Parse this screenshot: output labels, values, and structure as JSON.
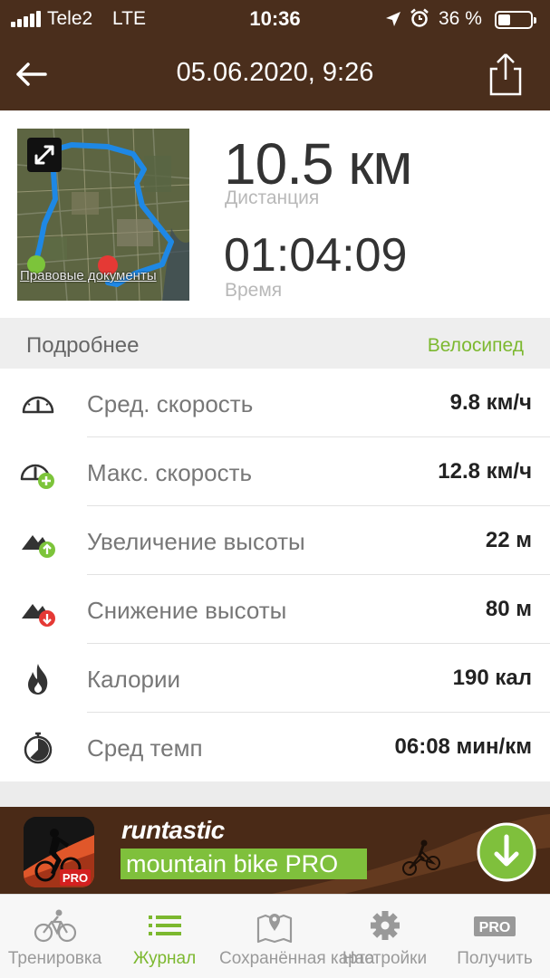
{
  "status_bar": {
    "carrier": "Tele2",
    "network": "LTE",
    "time": "10:36",
    "battery_percent": "36 %",
    "battery_level": 0.36,
    "icons": [
      "signal-icon",
      "location-arrow-icon",
      "alarm-icon",
      "battery-icon"
    ]
  },
  "header": {
    "title": "05.06.2020, 9:26",
    "back_icon": "back-arrow-icon",
    "share_icon": "share-icon"
  },
  "summary": {
    "map_legal": "Правовые документы",
    "distance_value": "10.5 км",
    "distance_label": "Дистанция",
    "time_value": "01:04:09",
    "time_label": "Время"
  },
  "details": {
    "title": "Подробнее",
    "sport": "Велосипед",
    "rows": [
      {
        "icon": "speedometer-icon",
        "label": "Сред. скорость",
        "value": "9.8 км/ч"
      },
      {
        "icon": "speedometer-plus-icon",
        "label": "Макс. скорость",
        "value": "12.8 км/ч"
      },
      {
        "icon": "elevation-gain-icon",
        "label": "Увеличение высоты",
        "value": "22 м"
      },
      {
        "icon": "elevation-loss-icon",
        "label": "Снижение высоты",
        "value": "80 м"
      },
      {
        "icon": "flame-icon",
        "label": "Калории",
        "value": "190 кал"
      },
      {
        "icon": "stopwatch-icon",
        "label": "Сред темп",
        "value": "06:08 мин/км"
      }
    ]
  },
  "ad": {
    "brand": "runtastic",
    "product": "mountain bike PRO",
    "badge": "PRO",
    "colors": {
      "background": "#4a2a17",
      "accent": "#7fc03c"
    }
  },
  "tabbar": {
    "tabs": [
      {
        "icon": "bicycle-icon",
        "label": "Тренировка",
        "active": false
      },
      {
        "icon": "list-icon",
        "label": "Журнал",
        "active": true
      },
      {
        "icon": "map-pin-icon",
        "label": "Сохранённая карта",
        "active": false
      },
      {
        "icon": "gear-icon",
        "label": "Настройки",
        "active": false
      },
      {
        "icon": "pro-badge-icon",
        "label": "Получить",
        "badge": "PRO",
        "active": false
      }
    ]
  },
  "colors": {
    "header_brown": "#4a2e1c",
    "accent_green": "#7cb82f",
    "route_blue": "#1e88e5",
    "start_green": "#7cc43a",
    "end_red": "#e53935"
  }
}
